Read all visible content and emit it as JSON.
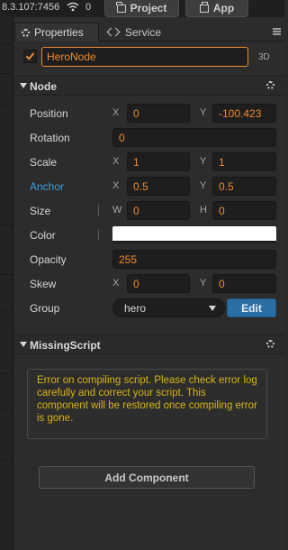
{
  "topbar": {
    "ip_text": "8.3.107:7456",
    "wifi_icon": "wifi-icon",
    "connection_count": "0",
    "project_label": "Project",
    "app_label": "App"
  },
  "tabs": {
    "properties_label": "Properties",
    "service_label": "Service"
  },
  "node": {
    "name": "HeroNode",
    "enabled": true,
    "badge_3d": "3D"
  },
  "node_section": {
    "title": "Node",
    "properties": {
      "position": {
        "label": "Position",
        "x_axis": "X",
        "x": "0",
        "y_axis": "Y",
        "y": "-100.423"
      },
      "rotation": {
        "label": "Rotation",
        "value": "0"
      },
      "scale": {
        "label": "Scale",
        "x_axis": "X",
        "x": "1",
        "y_axis": "Y",
        "y": "1"
      },
      "anchor": {
        "label": "Anchor",
        "x_axis": "X",
        "x": "0.5",
        "y_axis": "Y",
        "y": "0.5"
      },
      "size": {
        "label": "Size",
        "w_axis": "W",
        "w": "0",
        "h_axis": "H",
        "h": "0"
      },
      "color": {
        "label": "Color",
        "value": "#ffffff"
      },
      "opacity": {
        "label": "Opacity",
        "value": "255"
      },
      "skew": {
        "label": "Skew",
        "x_axis": "X",
        "x": "0",
        "y_axis": "Y",
        "y": "0"
      },
      "group": {
        "label": "Group",
        "value": "hero",
        "edit_label": "Edit"
      }
    }
  },
  "missing_script": {
    "title": "MissingScript",
    "error_text": "Error on compiling script. Please check error log carefully and correct your script. This component will be restored once compiling error is gone."
  },
  "add_component_label": "Add Component",
  "colors": {
    "accent_orange": "#f08a2a",
    "link_blue": "#3aa0dd",
    "edit_blue": "#2a6ea6",
    "warning_yellow": "#d8b418"
  }
}
